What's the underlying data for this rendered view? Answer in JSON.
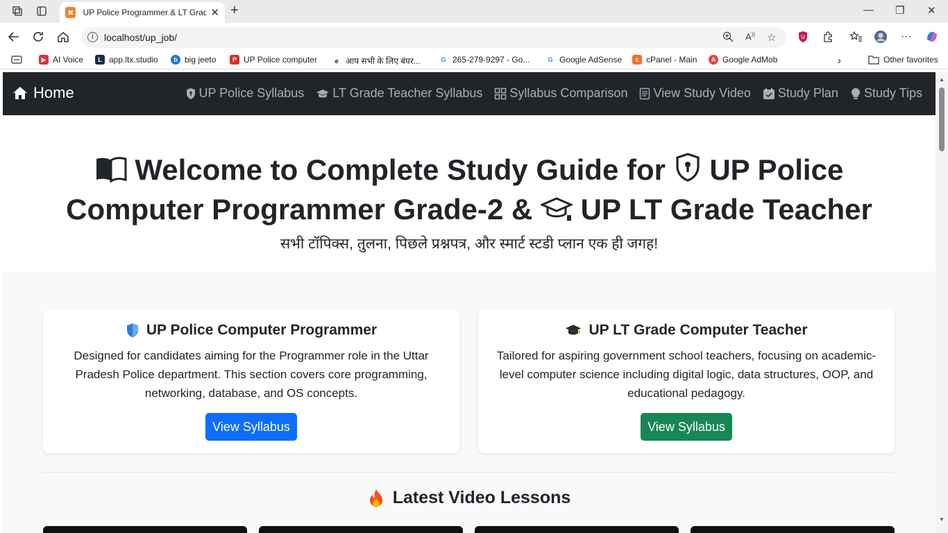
{
  "browser": {
    "tab_title": "UP Police Programmer & LT Grade",
    "url": "localhost/up_job/",
    "bookmarks": [
      {
        "label": "AI Voice",
        "color": "#e0313a",
        "glyph": "▶"
      },
      {
        "label": "app.ltx.studio",
        "color": "#1b2a4a",
        "glyph": "L"
      },
      {
        "label": "big jeeto",
        "color": "#1a73e8",
        "glyph": "b"
      },
      {
        "label": "UP Police computer",
        "color": "#d93025",
        "glyph": "P"
      },
      {
        "label": "आप सभी के लिए बंपर...",
        "color": "#222222",
        "glyph": "e"
      },
      {
        "label": "265-279-9297 - Go...",
        "color": "#4285f4",
        "glyph": "G"
      },
      {
        "label": "Google AdSense",
        "color": "#4285f4",
        "glyph": "G"
      },
      {
        "label": "cPanel - Main",
        "color": "#ff6c2c",
        "glyph": "c"
      },
      {
        "label": "Google AdMob",
        "color": "#ea4335",
        "glyph": "A"
      }
    ],
    "other_favorites": "Other favorites"
  },
  "navbar": {
    "brand": "Home",
    "links": [
      {
        "label": "UP Police Syllabus",
        "icon": "shield-icon"
      },
      {
        "label": "LT Grade Teacher Syllabus",
        "icon": "graduation-cap-icon"
      },
      {
        "label": "Syllabus Comparison",
        "icon": "grid-icon"
      },
      {
        "label": "View Study Video",
        "icon": "video-list-icon"
      },
      {
        "label": "Study Plan",
        "icon": "calendar-icon"
      },
      {
        "label": "Study Tips",
        "icon": "lightbulb-icon"
      }
    ]
  },
  "hero": {
    "title_part1": "Welcome to Complete Study Guide for",
    "title_part2": "UP Police Computer Programmer Grade-2 &",
    "title_part3": "UP LT Grade Teacher",
    "subtitle": "सभी टॉपिक्स, तुलना, पिछले प्रश्नपत्र, और स्मार्ट स्टडी प्लान एक ही जगह!"
  },
  "cards": [
    {
      "title": "UP Police Computer Programmer",
      "text": "Designed for candidates aiming for the Programmer role in the Uttar Pradesh Police department. This section covers core programming, networking, database, and OS concepts.",
      "button": "View Syllabus",
      "button_color": "#0d6efd"
    },
    {
      "title": "UP LT Grade Computer Teacher",
      "text": "Tailored for aspiring government school teachers, focusing on academic-level computer science including digital logic, data structures, OOP, and educational pedagogy.",
      "button": "View Syllabus",
      "button_color": "#198754"
    }
  ],
  "videos_section": {
    "title": "Latest Video Lessons"
  },
  "colors": {
    "navbar_bg": "#212529",
    "page_bg": "#f8f9fa",
    "primary": "#0d6efd",
    "success": "#198754"
  }
}
